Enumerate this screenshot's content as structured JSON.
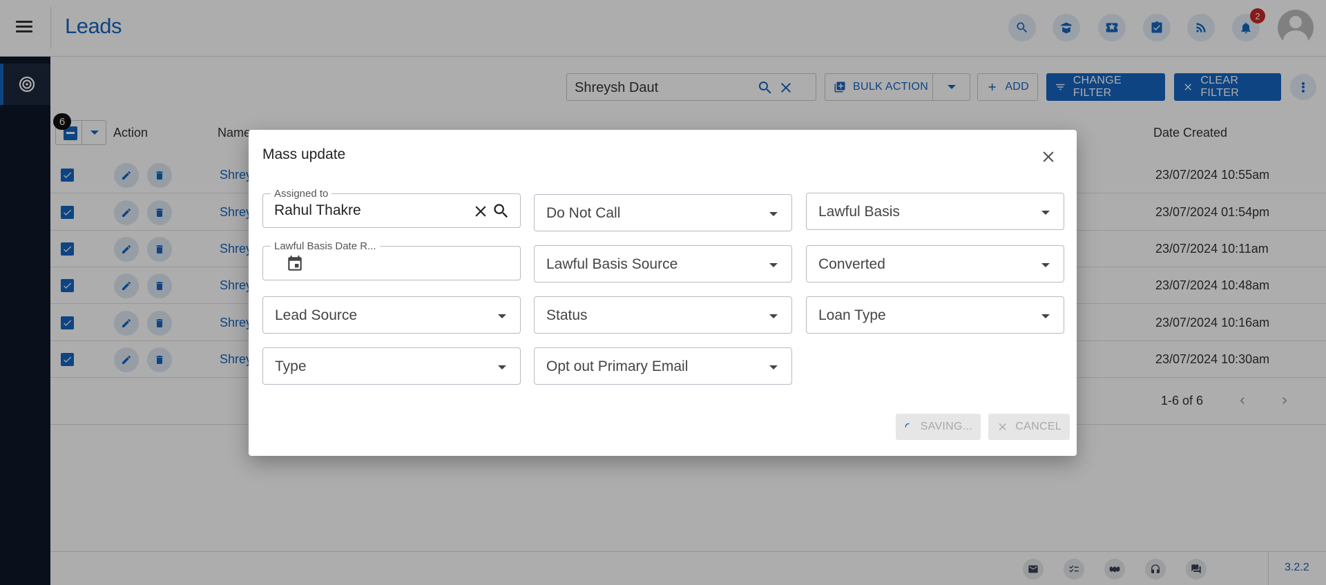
{
  "header": {
    "title": "Leads",
    "notifications_count": "2",
    "icons": [
      "search-icon",
      "book-icon",
      "ticket-icon",
      "task-icon",
      "rss-icon",
      "bell-icon"
    ]
  },
  "toolbar": {
    "search_value": "Shreysh Daut",
    "bulk_action_label": "BULK ACTION",
    "add_label": "ADD",
    "change_filter_label": "CHANGE FILTER",
    "clear_filter_label": "CLEAR FILTER"
  },
  "table": {
    "selected_count": "6",
    "columns": {
      "action": "Action",
      "name": "Name",
      "date_created": "Date Created"
    },
    "rows": [
      {
        "name": "Shreysh Daut",
        "date": "23/07/2024 10:55am"
      },
      {
        "name": "Shreysh Daut",
        "date": "23/07/2024 01:54pm"
      },
      {
        "name": "Shreysh Daut",
        "date": "23/07/2024 10:11am"
      },
      {
        "name": "Shreysh Daut",
        "date": "23/07/2024 10:48am"
      },
      {
        "name": "Shreysh Daut",
        "date": "23/07/2024 10:16am"
      },
      {
        "name": "Shreysh Daut",
        "date": "23/07/2024 10:30am"
      }
    ],
    "pagination": "1-6 of 6"
  },
  "modal": {
    "title": "Mass update",
    "assigned_to_label": "Assigned to",
    "assigned_to_value": "Rahul Thakre",
    "lawful_basis_date_label": "Lawful Basis Date R...",
    "fields": {
      "do_not_call": "Do Not Call",
      "lawful_basis": "Lawful Basis",
      "lawful_basis_source": "Lawful Basis Source",
      "converted": "Converted",
      "lead_source": "Lead Source",
      "status": "Status",
      "loan_type": "Loan Type",
      "type": "Type",
      "opt_out_primary_email": "Opt out Primary Email"
    },
    "saving_label": "SAVING...",
    "cancel_label": "CANCEL"
  },
  "footer": {
    "version": "3.2.2",
    "icons": [
      "mail-icon",
      "checklist-icon",
      "handshake-icon",
      "headset-icon",
      "chat-icon"
    ]
  },
  "colors": {
    "primary": "#1565c0",
    "sidebar": "#0f172a",
    "badge": "#c62828"
  }
}
